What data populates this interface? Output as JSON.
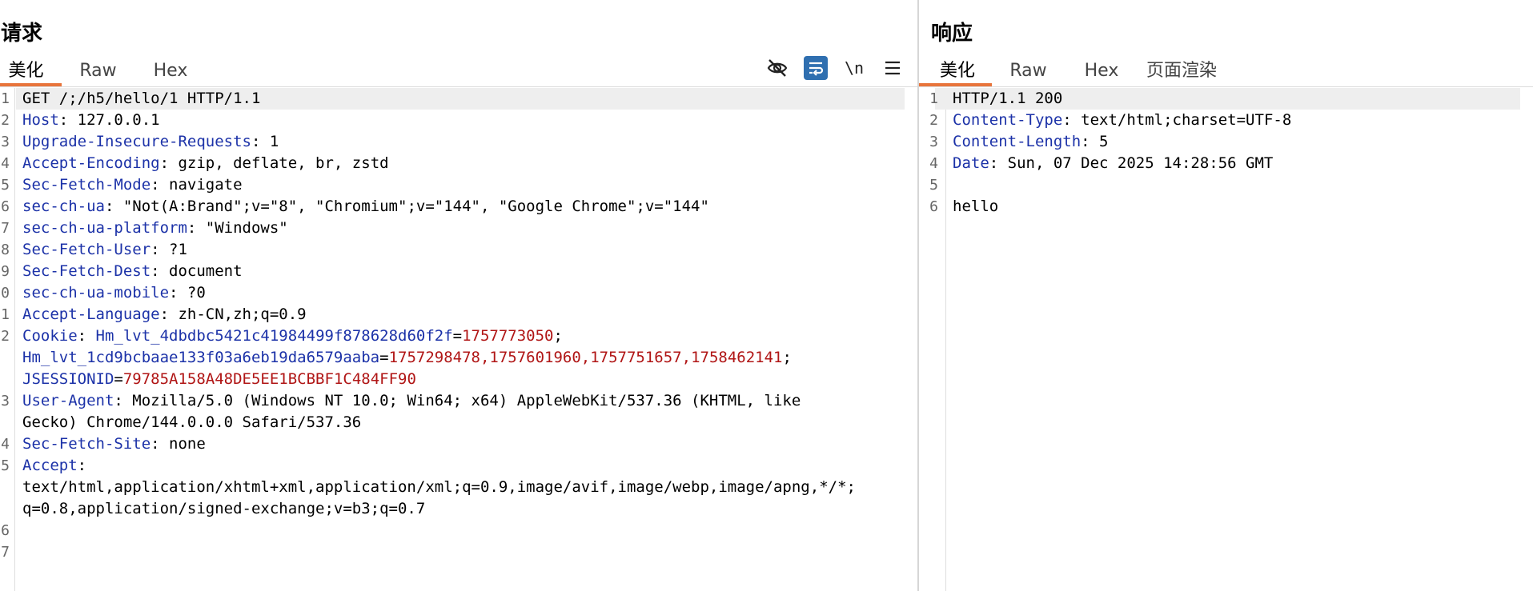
{
  "request": {
    "title": "请求",
    "tabs": [
      "美化",
      "Raw",
      "Hex"
    ],
    "active_tab": 0,
    "toolbar": {
      "newline_label": "\\n"
    },
    "line_numbers": [
      "1",
      "2",
      "3",
      "4",
      "5",
      "6",
      "7",
      "8",
      "9",
      "0",
      "1",
      "2",
      "",
      "",
      "3",
      "",
      "4",
      "5",
      "",
      "",
      "6",
      "7"
    ],
    "lines": [
      {
        "parts": [
          {
            "t": "GET /;/h5/hello/1 HTTP/1.1",
            "c": "val"
          }
        ]
      },
      {
        "parts": [
          {
            "t": "Host",
            "c": "key"
          },
          {
            "t": ": 127.0.0.1",
            "c": "val"
          }
        ]
      },
      {
        "parts": [
          {
            "t": "Upgrade-Insecure-Requests",
            "c": "key"
          },
          {
            "t": ": 1",
            "c": "val"
          }
        ]
      },
      {
        "parts": [
          {
            "t": "Accept-Encoding",
            "c": "key"
          },
          {
            "t": ": gzip, deflate, br, zstd",
            "c": "val"
          }
        ]
      },
      {
        "parts": [
          {
            "t": "Sec-Fetch-Mode",
            "c": "key"
          },
          {
            "t": ": navigate",
            "c": "val"
          }
        ]
      },
      {
        "parts": [
          {
            "t": "sec-ch-ua",
            "c": "key"
          },
          {
            "t": ": \"Not(A:Brand\";v=\"8\", \"Chromium\";v=\"144\", \"Google Chrome\";v=\"144\"",
            "c": "val"
          }
        ]
      },
      {
        "parts": [
          {
            "t": "sec-ch-ua-platform",
            "c": "key"
          },
          {
            "t": ": \"Windows\"",
            "c": "val"
          }
        ]
      },
      {
        "parts": [
          {
            "t": "Sec-Fetch-User",
            "c": "key"
          },
          {
            "t": ": ?1",
            "c": "val"
          }
        ]
      },
      {
        "parts": [
          {
            "t": "Sec-Fetch-Dest",
            "c": "key"
          },
          {
            "t": ": document",
            "c": "val"
          }
        ]
      },
      {
        "parts": [
          {
            "t": "sec-ch-ua-mobile",
            "c": "key"
          },
          {
            "t": ": ?0",
            "c": "val"
          }
        ]
      },
      {
        "parts": [
          {
            "t": "Accept-Language",
            "c": "key"
          },
          {
            "t": ": zh-CN,zh;q=0.9",
            "c": "val"
          }
        ]
      },
      {
        "parts": [
          {
            "t": "Cookie",
            "c": "key"
          },
          {
            "t": ": ",
            "c": "val"
          },
          {
            "t": "Hm_lvt_4dbdbc5421c41984499f878628d60f2f",
            "c": "ckey"
          },
          {
            "t": "=",
            "c": "punct"
          },
          {
            "t": "1757773050",
            "c": "cval"
          },
          {
            "t": ";",
            "c": "punct"
          }
        ]
      },
      {
        "parts": [
          {
            "t": "Hm_lvt_1cd9bcbaae133f03a6eb19da6579aaba",
            "c": "ckey"
          },
          {
            "t": "=",
            "c": "punct"
          },
          {
            "t": "1757298478,1757601960,1757751657,1758462141",
            "c": "cval"
          },
          {
            "t": ";",
            "c": "punct"
          }
        ]
      },
      {
        "parts": [
          {
            "t": "JSESSIONID",
            "c": "ckey"
          },
          {
            "t": "=",
            "c": "punct"
          },
          {
            "t": "79785A158A48DE5EE1BCBBF1C484FF90",
            "c": "cval"
          }
        ]
      },
      {
        "parts": [
          {
            "t": "User-Agent",
            "c": "key"
          },
          {
            "t": ": Mozilla/5.0 (Windows NT 10.0; Win64; x64) AppleWebKit/537.36 (KHTML, like",
            "c": "val"
          }
        ]
      },
      {
        "parts": [
          {
            "t": "Gecko) Chrome/144.0.0.0 Safari/537.36",
            "c": "val"
          }
        ]
      },
      {
        "parts": [
          {
            "t": "Sec-Fetch-Site",
            "c": "key"
          },
          {
            "t": ": none",
            "c": "val"
          }
        ]
      },
      {
        "parts": [
          {
            "t": "Accept",
            "c": "key"
          },
          {
            "t": ":",
            "c": "val"
          }
        ]
      },
      {
        "parts": [
          {
            "t": "text/html,application/xhtml+xml,application/xml;q=0.9,image/avif,image/webp,image/apng,*/*;",
            "c": "val"
          }
        ]
      },
      {
        "parts": [
          {
            "t": "q=0.8,application/signed-exchange;v=b3;q=0.7",
            "c": "val"
          }
        ]
      },
      {
        "parts": []
      },
      {
        "parts": []
      }
    ]
  },
  "response": {
    "title": "响应",
    "tabs": [
      "美化",
      "Raw",
      "Hex",
      "页面渲染"
    ],
    "active_tab": 0,
    "line_numbers": [
      "1",
      "2",
      "3",
      "4",
      "5",
      "6"
    ],
    "lines": [
      {
        "parts": [
          {
            "t": "HTTP/1.1 200",
            "c": "val"
          }
        ]
      },
      {
        "parts": [
          {
            "t": "Content-Type",
            "c": "key"
          },
          {
            "t": ": text/html;charset=UTF-8",
            "c": "val"
          }
        ]
      },
      {
        "parts": [
          {
            "t": "Content-Length",
            "c": "key"
          },
          {
            "t": ": 5",
            "c": "val"
          }
        ]
      },
      {
        "parts": [
          {
            "t": "Date",
            "c": "key"
          },
          {
            "t": ": Sun, 07 Dec 2025 14:28:56 GMT",
            "c": "val"
          }
        ]
      },
      {
        "parts": []
      },
      {
        "parts": [
          {
            "t": "hello",
            "c": "val"
          }
        ]
      }
    ]
  },
  "colors": {
    "accent_tab_underline": "#e8743b",
    "header_key": "#1c32a8",
    "cookie_value": "#b01515",
    "wrap_button_bg": "#2f6fb0",
    "current_line_bg": "#eeeeee"
  },
  "icons": [
    "eye-off-icon",
    "word-wrap-icon",
    "newline-toggle-icon",
    "menu-icon"
  ]
}
